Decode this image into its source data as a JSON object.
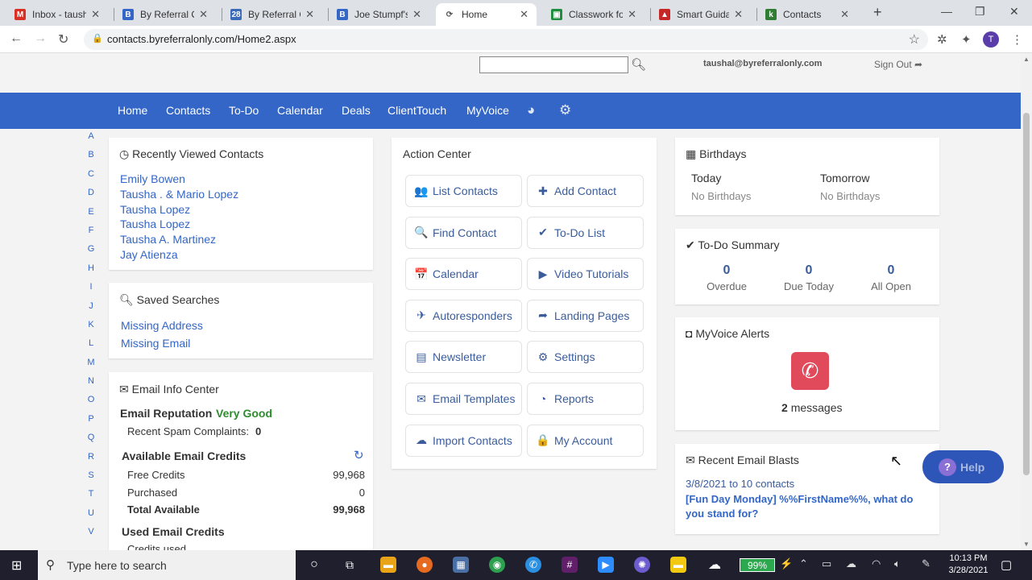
{
  "browser": {
    "tabs": [
      {
        "title": "Inbox - tausha",
        "icon": "gmail-icon",
        "color": "#d93025",
        "glyph": "M"
      },
      {
        "title": "By Referral On",
        "icon": "b-logo-icon",
        "color": "#3366c6",
        "glyph": "B"
      },
      {
        "title": "By Referral On",
        "icon": "calendar-icon",
        "color": "#3a6ab8",
        "glyph": "28"
      },
      {
        "title": "Joe Stumpf's |",
        "icon": "b-logo-icon",
        "color": "#3366c6",
        "glyph": "B"
      },
      {
        "title": "Home",
        "icon": "refresh-logo-icon",
        "color": "#555555",
        "glyph": "⟳",
        "active": true
      },
      {
        "title": "Classwork for",
        "icon": "classroom-icon",
        "color": "#1e8e3e",
        "glyph": "▣"
      },
      {
        "title": "Smart Guidan",
        "icon": "triangle-logo-icon",
        "color": "#c62828",
        "glyph": "▲"
      },
      {
        "title": "Contacts",
        "icon": "k-logo-icon",
        "color": "#2e7d32",
        "glyph": "k"
      }
    ],
    "url": "contacts.byreferralonly.com/Home2.aspx"
  },
  "header": {
    "user_email": "taushal@byreferralonly.com",
    "sign_out": "Sign Out"
  },
  "nav": {
    "items": [
      "Home",
      "Contacts",
      "To-Do",
      "Calendar",
      "Deals",
      "ClientTouch",
      "MyVoice"
    ]
  },
  "alphabet": [
    "A",
    "B",
    "C",
    "D",
    "E",
    "F",
    "G",
    "H",
    "I",
    "J",
    "K",
    "L",
    "M",
    "N",
    "O",
    "P",
    "Q",
    "R",
    "S",
    "T",
    "U",
    "V"
  ],
  "recent": {
    "title": "Recently Viewed Contacts",
    "contacts": [
      "Emily Bowen",
      "Tausha . & Mario Lopez",
      "Tausha Lopez",
      "Tausha Lopez",
      "Tausha A. Martinez",
      "Jay Atienza"
    ]
  },
  "saved": {
    "title": "Saved Searches",
    "items": [
      "Missing Address",
      "Missing Email"
    ]
  },
  "emailinfo": {
    "title": "Email Info Center",
    "reputation_label": "Email Reputation",
    "reputation_value": "Very Good",
    "spam_label": "Recent Spam Complaints:",
    "spam_value": "0",
    "credits_title": "Available Email Credits",
    "free_label": "Free Credits",
    "free_value": "99,968",
    "purchased_label": "Purchased",
    "purchased_value": "0",
    "total_label": "Total Available",
    "total_value": "99,968",
    "used_title": "Used Email Credits",
    "used_label": "Credits used"
  },
  "action_center": {
    "title": "Action Center",
    "buttons": [
      {
        "label": "List Contacts",
        "icon": "users-icon",
        "glyph": "👥"
      },
      {
        "label": "Add Contact",
        "icon": "plus-icon",
        "glyph": "✚"
      },
      {
        "label": "Find Contact",
        "icon": "search-icon",
        "glyph": "🔍"
      },
      {
        "label": "To-Do List",
        "icon": "check-icon",
        "glyph": "✔"
      },
      {
        "label": "Calendar",
        "icon": "calendar-icon",
        "glyph": "📅"
      },
      {
        "label": "Video Tutorials",
        "icon": "play-icon",
        "glyph": "▶"
      },
      {
        "label": "Autoresponders",
        "icon": "paper-plane-icon",
        "glyph": "✈"
      },
      {
        "label": "Landing Pages",
        "icon": "share-arrow-icon",
        "glyph": "➦"
      },
      {
        "label": "Newsletter",
        "icon": "newspaper-icon",
        "glyph": "▤"
      },
      {
        "label": "Settings",
        "icon": "gear-icon",
        "glyph": "⚙"
      },
      {
        "label": "Email Templates",
        "icon": "envelope-icon",
        "glyph": "✉"
      },
      {
        "label": "Reports",
        "icon": "pie-chart-icon",
        "glyph": "◔"
      },
      {
        "label": "Import Contacts",
        "icon": "cloud-upload-icon",
        "glyph": "☁"
      },
      {
        "label": "My Account",
        "icon": "lock-icon",
        "glyph": "🔒"
      }
    ]
  },
  "birthdays": {
    "title": "Birthdays",
    "today_label": "Today",
    "today_value": "No Birthdays",
    "tomorrow_label": "Tomorrow",
    "tomorrow_value": "No Birthdays"
  },
  "todo": {
    "title": "To-Do Summary",
    "overdue": "0",
    "overdue_label": "Overdue",
    "due_today": "0",
    "due_today_label": "Due Today",
    "all_open": "0",
    "all_open_label": "All Open"
  },
  "myvoice": {
    "title": "MyVoice Alerts",
    "count": "2",
    "count_label": "messages"
  },
  "blasts": {
    "title": "Recent Email Blasts",
    "line": "3/8/2021 to 10 contacts",
    "subject": "[Fun Day Monday] %%FirstName%%, what do you stand for?"
  },
  "help": {
    "label": "Help"
  },
  "taskbar": {
    "search_placeholder": "Type here to search",
    "battery": "99%",
    "time": "10:13 PM",
    "date": "3/28/2021"
  }
}
